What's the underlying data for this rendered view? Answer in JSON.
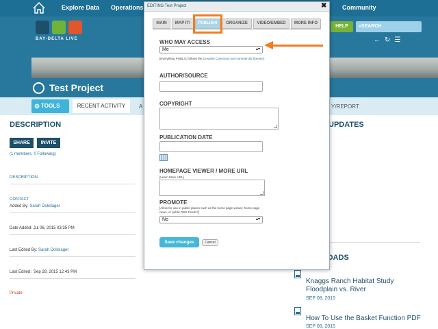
{
  "topnav": {
    "items": [
      "Explore Data",
      "Operations",
      "Community"
    ]
  },
  "header": {
    "brand": "BAY-DELTA LIVE",
    "help": "HELP",
    "search": "SEARCH"
  },
  "project": {
    "title": "Test Project"
  },
  "tabs": {
    "tools": "TOOLS",
    "activity": "RECENT ACTIVITY",
    "a": "A",
    "report": "Y/REPORT"
  },
  "left": {
    "description_heading": "DESCRIPTION",
    "share": "SHARE",
    "invite": "INVITE",
    "members": "(1 members, 0 Following)",
    "description_link": "DESCRIPTION",
    "contact": "CONTACT",
    "added_by_label": "Added By:",
    "added_by": "Sarah Dolislager",
    "date_added": "Date Added: Jul 06, 2015 03:35 PM",
    "last_edited_by_label": "Last Edited By:",
    "last_edited_by": "Sarah Dolislager",
    "last_edited": "Last Edited : Sep 28, 2015 12:43 PM",
    "privacy": "Private"
  },
  "right": {
    "updates_heading": "UPDATES",
    "downloads_heading": "OADS",
    "downloads": [
      {
        "title": "Knaggs Ranch Habitat Study Floodplain vs. River",
        "date": "SEP 08, 2015"
      },
      {
        "title": "How To Use the Basket Function PDF",
        "date": "SEP 08, 2015"
      }
    ]
  },
  "modal": {
    "title": "EDITING Test Project",
    "close": "✖",
    "tabs": [
      "MAIN",
      "MAP IT!",
      "PUBLISH!",
      "ORGANIZE",
      "VIDEO/EMBED",
      "MORE INFO"
    ],
    "active_tab": "PUBLISH!",
    "who_label": "WHO MAY ACCESS",
    "who_value": "Me",
    "who_note_prefix": "[Everything PUBLIC follows the ",
    "who_note_link": "Creative Commons non-commercial license",
    "who_note_suffix": ".]",
    "author_label": "AUTHOR/SOURCE",
    "copyright_label": "COPYRIGHT",
    "pubdate_label": "PUBLICATION DATE",
    "homepage_label": "HOMEPAGE VIEWER / MORE URL",
    "homepage_note": "[Learn More URL]",
    "promote_label": "PROMOTE",
    "promote_note": "[Allow for use in public places such as the home page viewer, home page news, or public RSS Feeds?]",
    "promote_value": "No",
    "save": "Save changes",
    "cancel": "Cancel"
  },
  "colors": {
    "nav": "#1d6f95",
    "header": "#28789e",
    "accent": "#f07d1e",
    "save": "#45b8d8"
  },
  "icons": [
    "home-icon",
    "gear-icon",
    "globe-icon",
    "calendar-icon",
    "download-icon",
    "close-icon"
  ]
}
